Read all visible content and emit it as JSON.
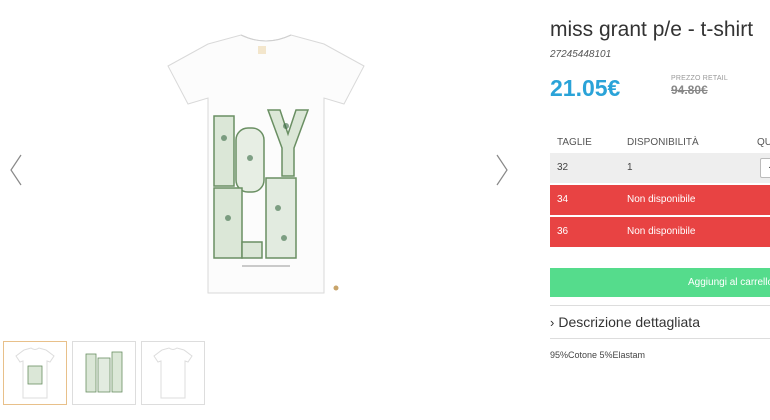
{
  "product": {
    "title": "miss grant p/e - t-shirt",
    "sku": "27245448101",
    "price": "21.05€",
    "retail_label": "PREZZO RETAIL",
    "retail_price": "94.80€"
  },
  "sizes_table": {
    "headers": {
      "size": "TAGLIE",
      "availability": "DISPONIBILITÀ",
      "quantity": "QU"
    },
    "rows": [
      {
        "size": "32",
        "availability": "1",
        "status": "available",
        "qty_value": "·"
      },
      {
        "size": "34",
        "availability": "Non disponibile",
        "status": "unavailable"
      },
      {
        "size": "36",
        "availability": "Non disponibile",
        "status": "unavailable"
      }
    ]
  },
  "actions": {
    "add_to_cart": "Aggiungi al carrello"
  },
  "description": {
    "toggle_icon": "chevron-right-icon",
    "toggle_label": "Descrizione dettagliata",
    "composition": "95%Cotone 5%Elastam"
  },
  "gallery": {
    "thumbnails": 3,
    "active_thumbnail": 1
  },
  "colors": {
    "price": "#2aa3d8",
    "unavailable": "#e84343",
    "add_to_cart": "#55dc8c",
    "active_thumb_border": "#e8c08a"
  }
}
